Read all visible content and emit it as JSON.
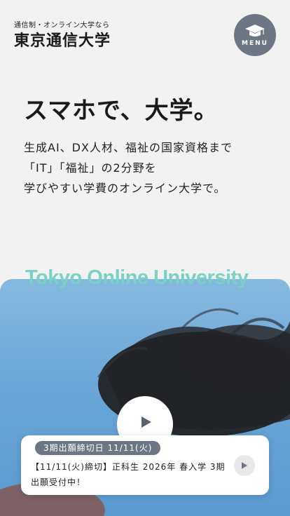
{
  "brand": {
    "tagline": "通信制・オンライン大学なら",
    "name": "東京通信大学"
  },
  "menu": {
    "label": "MENU",
    "icon": "graduation-cap-icon"
  },
  "hero": {
    "headline": "スマホで、大学。",
    "lead_lines": [
      "生成AI、DX人材、福祉の国家資格まで",
      "「IT」「福祉」の2分野を",
      "学びやすい学費のオンライン大学で。"
    ],
    "english_title": "Tokyo Online University",
    "play_icon": "play-icon"
  },
  "news": {
    "badge": "3期出願締切日 11/11(火)",
    "text": "【11/11(火)締切】正科生 2026年 春入学 3期 出願受付中！",
    "arrow_icon": "chevron-right-icon"
  },
  "colors": {
    "background": "#f2f2f2",
    "accent_gray": "#6d7784",
    "english_title": "#79d2c4",
    "sky": "#6aa6d7"
  }
}
